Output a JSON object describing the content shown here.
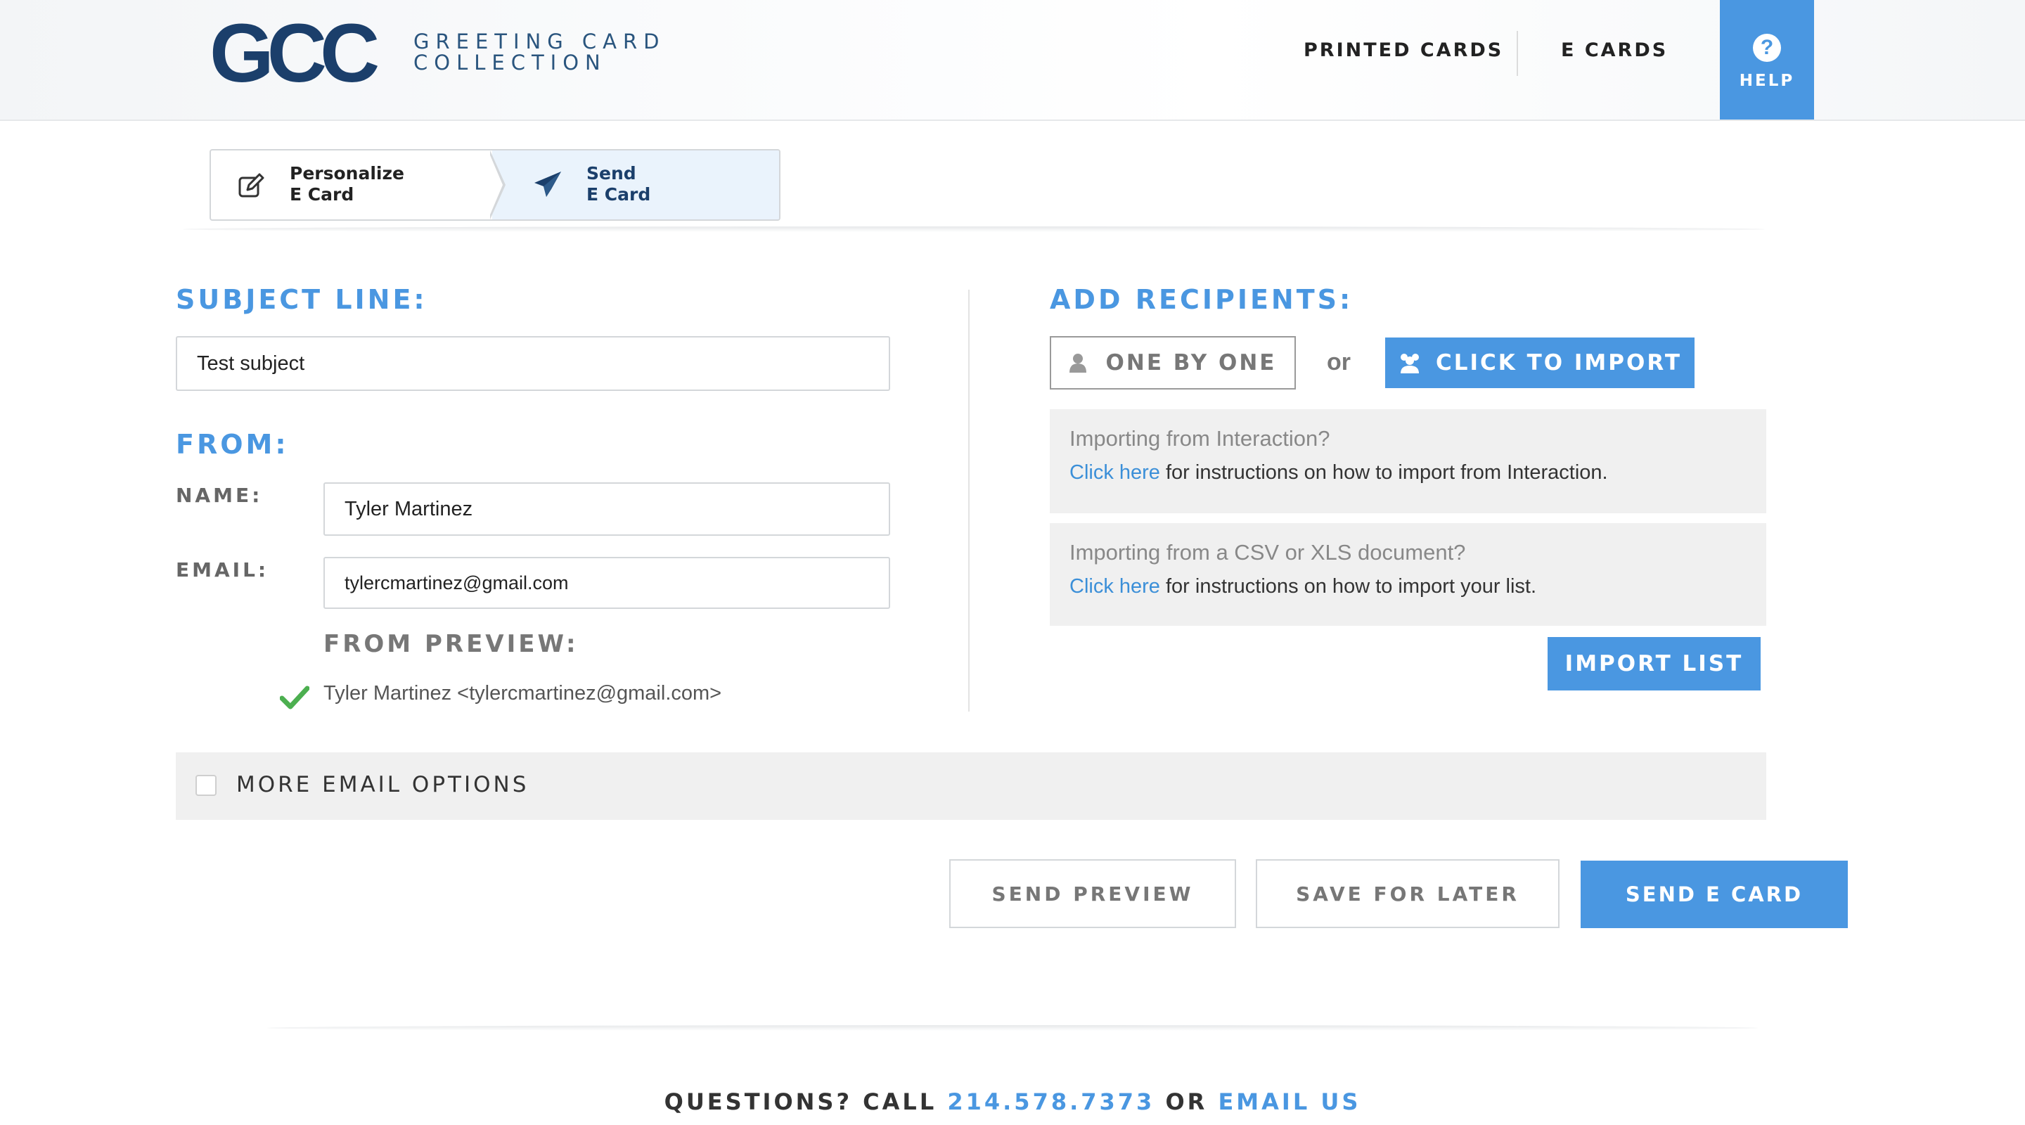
{
  "header": {
    "logo_text": "GCC",
    "brand_line1": "GREETING CARD",
    "brand_line2": "COLLECTION",
    "nav": [
      "PRINTED CARDS",
      "E CARDS"
    ],
    "help_label": "HELP",
    "help_icon": "question-circle-icon"
  },
  "steps": [
    {
      "line1": "Personalize",
      "line2": "E Card",
      "icon": "edit-icon",
      "active": false
    },
    {
      "line1": "Send",
      "line2": "E Card",
      "icon": "paper-plane-icon",
      "active": true
    }
  ],
  "subject": {
    "title": "SUBJECT LINE:",
    "value": "Test subject"
  },
  "from": {
    "title": "FROM:",
    "name_label": "NAME:",
    "name_value": "Tyler Martinez",
    "email_label": "EMAIL:",
    "email_value": "tylercmartinez@gmail.com",
    "preview_title": "FROM PREVIEW:",
    "preview_value": "Tyler Martinez <tylercmartinez@gmail.com>"
  },
  "recipients": {
    "title": "ADD RECIPIENTS:",
    "one_by_one": "ONE BY ONE",
    "or": "or",
    "import_button": "CLICK TO IMPORT",
    "interaction": {
      "title": "Importing from Interaction?",
      "link": "Click here",
      "text": " for instructions on how to import from Interaction."
    },
    "csv": {
      "title": "Importing from a CSV or XLS document?",
      "link": "Click here",
      "text": " for instructions on how to import your list."
    },
    "import_list": "IMPORT LIST"
  },
  "options": {
    "label": "MORE EMAIL OPTIONS",
    "checked": false
  },
  "actions": {
    "send_preview": "SEND PREVIEW",
    "save_later": "SAVE FOR LATER",
    "send": "SEND E CARD"
  },
  "footer": {
    "questions": "QUESTIONS? CALL ",
    "phone": "214.578.7373",
    "or": " OR ",
    "email": "EMAIL US"
  },
  "colors": {
    "accent": "#4a97e1",
    "brand": "#1b3f6b",
    "success": "#4caf50"
  }
}
